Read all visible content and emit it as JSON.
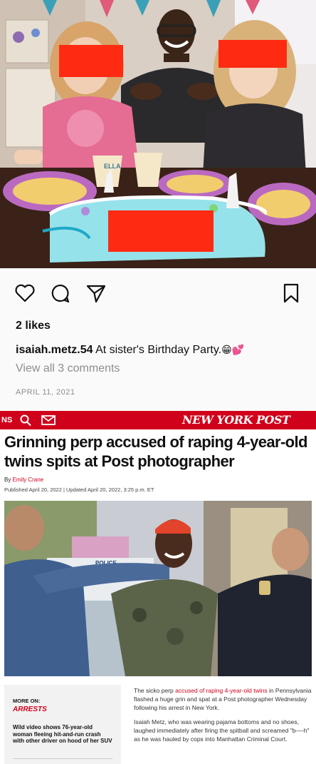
{
  "instagram": {
    "cake_label": "ELLA",
    "likes": "2 likes",
    "username": "isaiah.metz.54",
    "caption": "At sister's Birthday Party.",
    "caption_emoji": "😁💕",
    "view_comments": "View all 3 comments",
    "date": "APRIL 11, 2021",
    "icons": [
      "heart-icon",
      "comment-icon",
      "share-icon",
      "bookmark-icon"
    ]
  },
  "nypost": {
    "nav_section": "NS",
    "logo": "NEW YORK POST",
    "headline": "Grinning perp accused of raping 4-year-old twins spits at Post photographer",
    "byline_prefix": "By ",
    "author": "Emily Crane",
    "published": "Published April 20, 2022 | Updated April 20, 2022, 3:25 p.m. ET",
    "photo_sign": "POLICE",
    "sidebar": {
      "more_on": "MORE ON:",
      "tag": "ARRESTS",
      "story": "Wild video shows 76-year-old woman fleeing hit-and-run crash with other driver on hood of her SUV"
    },
    "body": {
      "p1_before": "The sicko perp ",
      "p1_link": "accused of raping 4-year-old twins",
      "p1_after": " in Pennsylvania flashed a huge grin and spat at a Post photographer Wednesday following his arrest in New York.",
      "p2": "Isaiah Metz, who was wearing pajama bottoms and no shoes, laughed immediately after firing the spitball and screamed \"b—-h\" as he was hauled by cops into Manhattan Criminal Court."
    },
    "colors": {
      "brand_red": "#d0021b",
      "redaction_red": "#ff2a12"
    }
  }
}
